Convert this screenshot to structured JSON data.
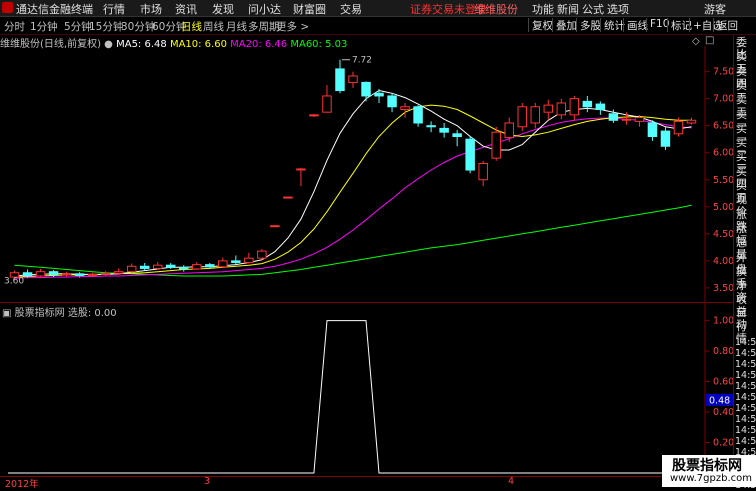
{
  "menu": {
    "app_title": "通达信金融终端",
    "items": [
      "行情",
      "市场",
      "资讯",
      "发现",
      "问小达",
      "财富圈",
      "交易"
    ],
    "notice": "证券交易未登录",
    "account": "维维股份",
    "right_items": [
      "功能",
      "新闻",
      "公式",
      "选项"
    ],
    "guest": "游客"
  },
  "periods": [
    "分时",
    "1分钟",
    "5分钟",
    "15分钟",
    "30分钟",
    "60分钟",
    "日线",
    "周线",
    "月线",
    "多周期",
    "更多 >"
  ],
  "active_period": "日线",
  "toolbar": [
    "复权",
    "叠加",
    "多股",
    "统计",
    "画线",
    "F10",
    "标记",
    "+自选",
    "返回"
  ],
  "legend": {
    "title": "维维股份(日线,前复权)",
    "ma5": "MA5: 6.48",
    "ma10": "MA10: 6.60",
    "ma20": "MA20: 6.46",
    "ma60": "MA60: 5.03"
  },
  "colors": {
    "ma5": "#ffffff",
    "ma10": "#ffff00",
    "ma20": "#ff00ff",
    "ma60": "#00ff00",
    "up": "#ff3232",
    "down": "#54ffff",
    "axis": "#800000"
  },
  "main_panel": {
    "high_label": "7.72",
    "low_label": "3.60",
    "y_ticks": [
      "7.50",
      "7.00",
      "6.50",
      "6.00",
      "5.50",
      "5.00",
      "4.50",
      "4.00",
      "3.50"
    ]
  },
  "indicator_panel": {
    "title": "股票指标网 选股: 0.00",
    "y_ticks": [
      "1.00",
      "0.80",
      "0.60",
      "0.40",
      "0.20"
    ],
    "current": "0.48"
  },
  "x_axis": {
    "labels": [
      "2012年",
      "3",
      "4"
    ]
  },
  "right_panel": {
    "quote_labels": [
      "委比",
      "卖五",
      "卖四",
      "卖三",
      "卖二",
      "卖一",
      "买一",
      "买二",
      "买三",
      "买四",
      "买五",
      "现价",
      "涨跌",
      "涨幅",
      "总量",
      "外盘",
      "换手",
      "净资",
      "收益"
    ],
    "tick_labels": [
      "自动",
      "行情"
    ],
    "times": [
      "14:5",
      "14:5",
      "14:5",
      "14:5",
      "14:5",
      "14:5",
      "14:5",
      "14:5",
      "14:5",
      "14:5",
      "14:5",
      "14:5",
      "14:5",
      "14:5"
    ]
  },
  "watermark": {
    "text": "股票指标网",
    "url": "www.7gpzb.com"
  },
  "chart_data": {
    "type": "candlestick",
    "price_range": [
      3.35,
      7.9
    ],
    "candles": [
      {
        "o": 3.7,
        "c": 3.78,
        "h": 3.82,
        "l": 3.66
      },
      {
        "o": 3.78,
        "c": 3.72,
        "h": 3.84,
        "l": 3.68
      },
      {
        "o": 3.72,
        "c": 3.8,
        "h": 3.85,
        "l": 3.69
      },
      {
        "o": 3.8,
        "c": 3.74,
        "h": 3.83,
        "l": 3.7
      },
      {
        "o": 3.74,
        "c": 3.76,
        "h": 3.8,
        "l": 3.71
      },
      {
        "o": 3.76,
        "c": 3.73,
        "h": 3.79,
        "l": 3.69
      },
      {
        "o": 3.73,
        "c": 3.75,
        "h": 3.78,
        "l": 3.7
      },
      {
        "o": 3.75,
        "c": 3.77,
        "h": 3.81,
        "l": 3.72
      },
      {
        "o": 3.77,
        "c": 3.8,
        "h": 3.86,
        "l": 3.74
      },
      {
        "o": 3.8,
        "c": 3.9,
        "h": 3.95,
        "l": 3.78
      },
      {
        "o": 3.9,
        "c": 3.86,
        "h": 3.96,
        "l": 3.83
      },
      {
        "o": 3.86,
        "c": 3.92,
        "h": 3.98,
        "l": 3.84
      },
      {
        "o": 3.92,
        "c": 3.88,
        "h": 3.96,
        "l": 3.85
      },
      {
        "o": 3.88,
        "c": 3.85,
        "h": 3.92,
        "l": 3.8
      },
      {
        "o": 3.85,
        "c": 3.93,
        "h": 3.98,
        "l": 3.83
      },
      {
        "o": 3.93,
        "c": 3.89,
        "h": 3.96,
        "l": 3.86
      },
      {
        "o": 3.89,
        "c": 4.0,
        "h": 4.06,
        "l": 3.87
      },
      {
        "o": 4.0,
        "c": 3.97,
        "h": 4.1,
        "l": 3.94
      },
      {
        "o": 3.97,
        "c": 4.05,
        "h": 4.15,
        "l": 3.95
      },
      {
        "o": 4.05,
        "c": 4.18,
        "h": 4.22,
        "l": 4.02
      },
      {
        "o": 4.65,
        "c": 4.65,
        "h": 4.65,
        "l": 4.65
      },
      {
        "o": 5.18,
        "c": 5.18,
        "h": 5.18,
        "l": 5.18
      },
      {
        "o": 5.7,
        "c": 5.7,
        "h": 5.72,
        "l": 5.38
      },
      {
        "o": 6.7,
        "c": 6.7,
        "h": 6.72,
        "l": 6.66
      },
      {
        "o": 6.75,
        "c": 7.05,
        "h": 7.25,
        "l": 6.75
      },
      {
        "o": 7.55,
        "c": 7.15,
        "h": 7.72,
        "l": 7.1
      },
      {
        "o": 7.3,
        "c": 7.42,
        "h": 7.5,
        "l": 7.2
      },
      {
        "o": 7.3,
        "c": 7.05,
        "h": 7.32,
        "l": 6.95
      },
      {
        "o": 7.1,
        "c": 7.05,
        "h": 7.18,
        "l": 6.92
      },
      {
        "o": 7.05,
        "c": 6.85,
        "h": 7.1,
        "l": 6.75
      },
      {
        "o": 6.8,
        "c": 6.85,
        "h": 6.92,
        "l": 6.65
      },
      {
        "o": 6.85,
        "c": 6.55,
        "h": 6.88,
        "l": 6.48
      },
      {
        "o": 6.5,
        "c": 6.48,
        "h": 6.58,
        "l": 6.38
      },
      {
        "o": 6.45,
        "c": 6.38,
        "h": 6.55,
        "l": 6.28
      },
      {
        "o": 6.35,
        "c": 6.3,
        "h": 6.42,
        "l": 6.12
      },
      {
        "o": 6.25,
        "c": 5.68,
        "h": 6.3,
        "l": 5.62
      },
      {
        "o": 5.5,
        "c": 5.8,
        "h": 5.85,
        "l": 5.38
      },
      {
        "o": 5.9,
        "c": 6.38,
        "h": 6.48,
        "l": 5.85
      },
      {
        "o": 6.28,
        "c": 6.55,
        "h": 6.65,
        "l": 6.2
      },
      {
        "o": 6.48,
        "c": 6.85,
        "h": 6.92,
        "l": 6.4
      },
      {
        "o": 6.55,
        "c": 6.85,
        "h": 6.92,
        "l": 6.45
      },
      {
        "o": 6.75,
        "c": 6.88,
        "h": 6.98,
        "l": 6.6
      },
      {
        "o": 6.7,
        "c": 6.92,
        "h": 7.0,
        "l": 6.62
      },
      {
        "o": 6.7,
        "c": 7.0,
        "h": 7.05,
        "l": 6.6
      },
      {
        "o": 6.95,
        "c": 6.85,
        "h": 7.05,
        "l": 6.75
      },
      {
        "o": 6.9,
        "c": 6.8,
        "h": 6.95,
        "l": 6.7
      },
      {
        "o": 6.72,
        "c": 6.6,
        "h": 6.8,
        "l": 6.55
      },
      {
        "o": 6.62,
        "c": 6.62,
        "h": 6.75,
        "l": 6.52
      },
      {
        "o": 6.58,
        "c": 6.65,
        "h": 6.7,
        "l": 6.48
      },
      {
        "o": 6.55,
        "c": 6.3,
        "h": 6.6,
        "l": 6.22
      },
      {
        "o": 6.4,
        "c": 6.12,
        "h": 6.48,
        "l": 6.05
      },
      {
        "o": 6.35,
        "c": 6.58,
        "h": 6.65,
        "l": 6.3
      },
      {
        "o": 6.55,
        "c": 6.6,
        "h": 6.65,
        "l": 6.52
      }
    ],
    "ma5": [
      3.72,
      3.74,
      3.75,
      3.76,
      3.76,
      3.75,
      3.75,
      3.75,
      3.76,
      3.79,
      3.82,
      3.85,
      3.88,
      3.88,
      3.89,
      3.89,
      3.91,
      3.93,
      3.97,
      4.02,
      4.17,
      4.42,
      4.77,
      5.28,
      5.86,
      6.36,
      6.72,
      7.0,
      7.15,
      7.1,
      7.02,
      6.9,
      6.77,
      6.62,
      6.5,
      6.3,
      6.12,
      6.05,
      6.05,
      6.15,
      6.38,
      6.6,
      6.75,
      6.8,
      6.82,
      6.8,
      6.75,
      6.7,
      6.66,
      6.58,
      6.48,
      6.44,
      6.48
    ],
    "ma10": [
      3.7,
      3.71,
      3.72,
      3.73,
      3.74,
      3.74,
      3.75,
      3.75,
      3.76,
      3.77,
      3.78,
      3.8,
      3.82,
      3.84,
      3.85,
      3.86,
      3.88,
      3.9,
      3.92,
      3.95,
      4.03,
      4.16,
      4.34,
      4.59,
      4.91,
      5.27,
      5.62,
      5.98,
      6.3,
      6.55,
      6.75,
      6.85,
      6.88,
      6.86,
      6.8,
      6.68,
      6.55,
      6.42,
      6.33,
      6.3,
      6.33,
      6.38,
      6.45,
      6.52,
      6.58,
      6.62,
      6.65,
      6.66,
      6.67,
      6.65,
      6.62,
      6.6,
      6.6
    ],
    "ma20": [
      3.68,
      3.69,
      3.69,
      3.7,
      3.7,
      3.71,
      3.71,
      3.72,
      3.72,
      3.73,
      3.74,
      3.75,
      3.76,
      3.77,
      3.78,
      3.79,
      3.8,
      3.82,
      3.84,
      3.86,
      3.9,
      3.96,
      4.03,
      4.13,
      4.25,
      4.4,
      4.57,
      4.76,
      4.96,
      5.15,
      5.35,
      5.52,
      5.68,
      5.82,
      5.94,
      6.02,
      6.1,
      6.18,
      6.26,
      6.35,
      6.43,
      6.5,
      6.56,
      6.6,
      6.63,
      6.64,
      6.64,
      6.62,
      6.6,
      6.56,
      6.52,
      6.48,
      6.46
    ],
    "ma60": [
      3.92,
      3.9,
      3.88,
      3.86,
      3.84,
      3.82,
      3.8,
      3.78,
      3.77,
      3.76,
      3.75,
      3.74,
      3.73,
      3.72,
      3.72,
      3.72,
      3.72,
      3.73,
      3.74,
      3.75,
      3.78,
      3.81,
      3.84,
      3.88,
      3.92,
      3.96,
      4.0,
      4.04,
      4.08,
      4.12,
      4.16,
      4.2,
      4.24,
      4.27,
      4.3,
      4.34,
      4.38,
      4.42,
      4.46,
      4.5,
      4.54,
      4.58,
      4.62,
      4.66,
      4.7,
      4.74,
      4.78,
      4.82,
      4.86,
      4.9,
      4.94,
      4.98,
      5.03
    ],
    "indicator": {
      "range": [
        0,
        1.05
      ],
      "signal_start_index": 24,
      "signal_end_index": 27,
      "values_note": "0 everywhere except spike to 1.00"
    }
  }
}
